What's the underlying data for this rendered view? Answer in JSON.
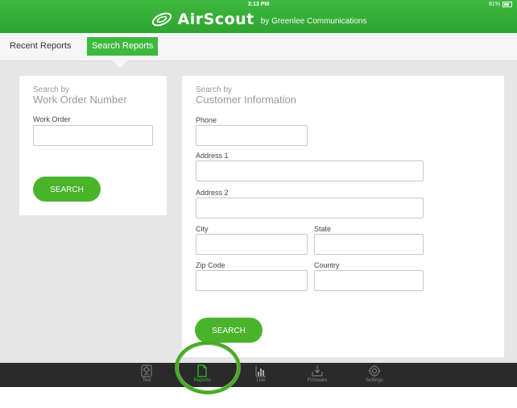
{
  "status": {
    "time": "3:13 PM",
    "battery": "81%"
  },
  "header": {
    "brand_name": "AirScout",
    "brand_sub": "by Greenlee Communications",
    "logo_icon": "airscout-swirl-logo"
  },
  "tabs": [
    {
      "label": "Recent Reports",
      "active": false
    },
    {
      "label": "Search Reports",
      "active": true
    }
  ],
  "work_order_panel": {
    "heading_line1": "Search by",
    "heading_line2": "Work Order Number",
    "work_order_label": "Work Order",
    "work_order_value": "",
    "search_label": "SEARCH"
  },
  "customer_panel": {
    "heading_line1": "Search by",
    "heading_line2": "Customer Information",
    "phone_label": "Phone",
    "address1_label": "Address 1",
    "address2_label": "Address 2",
    "city_label": "City",
    "state_label": "State",
    "zip_label": "Zip Code",
    "country_label": "Country",
    "search_label": "SEARCH"
  },
  "nav": [
    {
      "label": "Test",
      "icon": "test-icon",
      "active": false
    },
    {
      "label": "Reports",
      "icon": "reports-document-icon",
      "active": true
    },
    {
      "label": "Live",
      "icon": "live-bars-icon",
      "active": false
    },
    {
      "label": "Firmware",
      "icon": "firmware-download-icon",
      "active": false
    },
    {
      "label": "Settings",
      "icon": "settings-gear-icon",
      "active": false
    }
  ],
  "colors": {
    "brand_green": "#3fb83f",
    "button_green": "#49b32a",
    "nav_bg": "#2a2a2a"
  }
}
